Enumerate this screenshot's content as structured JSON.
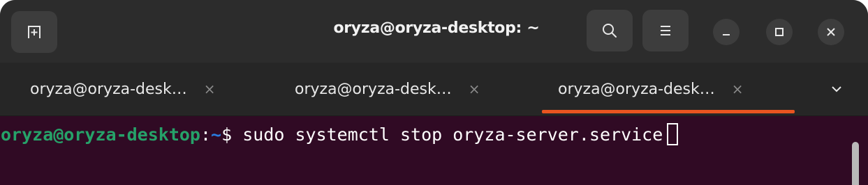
{
  "window": {
    "title": "oryza@oryza-desktop: ~"
  },
  "headerbar": {
    "new_tab_icon": "new-tab-icon",
    "search_icon": "search-icon",
    "menu_icon": "hamburger-menu-icon",
    "minimize_icon": "minimize-icon",
    "maximize_icon": "maximize-icon",
    "close_icon": "close-icon"
  },
  "tabs": [
    {
      "label": "oryza@oryza-desk…",
      "close": "×",
      "active": false
    },
    {
      "label": "oryza@oryza-desk…",
      "close": "×",
      "active": false
    },
    {
      "label": "oryza@oryza-desk…",
      "close": "×",
      "active": true
    }
  ],
  "tabbar": {
    "dropdown_icon": "chevron-down-icon"
  },
  "terminal": {
    "prompt_user": "oryza@oryza-desktop",
    "prompt_colon": ":",
    "prompt_path": "~",
    "prompt_symbol": "$ ",
    "command": "sudo systemctl stop oryza-server.service"
  },
  "colors": {
    "accent": "#e95420",
    "terminal_bg": "#300a24",
    "prompt_user": "#26a269",
    "prompt_path": "#2a7bde"
  }
}
